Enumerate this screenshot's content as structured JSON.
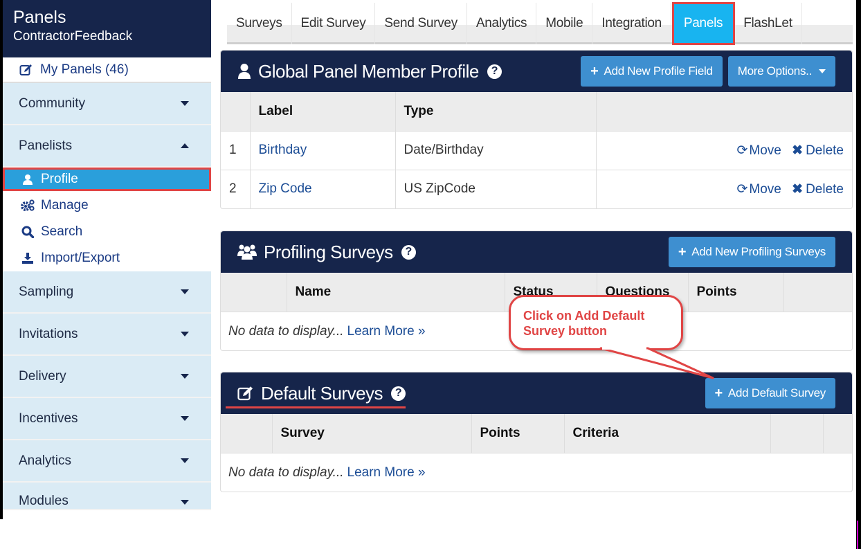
{
  "sidebar": {
    "title": "Panels",
    "subtitle": "ContractorFeedback",
    "my_panels": "My Panels (46)",
    "sections": [
      {
        "label": "Community",
        "expanded": false
      },
      {
        "label": "Panelists",
        "expanded": true
      },
      {
        "label": "Sampling",
        "expanded": false
      },
      {
        "label": "Invitations",
        "expanded": false
      },
      {
        "label": "Delivery",
        "expanded": false
      },
      {
        "label": "Incentives",
        "expanded": false
      },
      {
        "label": "Analytics",
        "expanded": false
      },
      {
        "label": "Modules",
        "expanded": false
      }
    ],
    "panelists_items": [
      {
        "label": "Profile",
        "icon": "user-icon",
        "active": true
      },
      {
        "label": "Manage",
        "icon": "gears-icon"
      },
      {
        "label": "Search",
        "icon": "search-icon"
      },
      {
        "label": "Import/Export",
        "icon": "download-icon"
      }
    ]
  },
  "tabs": [
    {
      "label": "Surveys"
    },
    {
      "label": "Edit Survey"
    },
    {
      "label": "Send Survey"
    },
    {
      "label": "Analytics"
    },
    {
      "label": "Mobile"
    },
    {
      "label": "Integration"
    },
    {
      "label": "Panels",
      "active": true
    },
    {
      "label": "FlashLet"
    }
  ],
  "global_profile": {
    "title": "Global Panel Member Profile",
    "help": "?",
    "add_button": "Add New Profile Field",
    "more_button": "More Options..",
    "columns": [
      "Label",
      "Type"
    ],
    "rows": [
      {
        "num": "1",
        "label": "Birthday",
        "type": "Date/Birthday",
        "move": "Move",
        "delete": "Delete"
      },
      {
        "num": "2",
        "label": "Zip Code",
        "type": "US ZipCode",
        "move": "Move",
        "delete": "Delete"
      }
    ]
  },
  "profiling_surveys": {
    "title": "Profiling Surveys",
    "help": "?",
    "add_button": "Add New Profiling Surveys",
    "columns": [
      "Name",
      "Status",
      "Questions",
      "Points"
    ],
    "empty_text": "No data to display...",
    "learn_more": "Learn More »"
  },
  "default_surveys": {
    "title": "Default Surveys",
    "help": "?",
    "add_button": "Add Default Survey",
    "columns": [
      "Survey",
      "Points",
      "Criteria"
    ],
    "empty_text": "No data to display...",
    "learn_more": "Learn More »"
  },
  "callout": {
    "text": "Click on Add Default Survey button",
    "color": "#e04545"
  },
  "colors": {
    "navy": "#16254b",
    "accent_blue": "#3e8fd0",
    "active_tab": "#18b4f0",
    "sidebar_bg": "#daebf5",
    "highlight_red": "#e04545"
  }
}
